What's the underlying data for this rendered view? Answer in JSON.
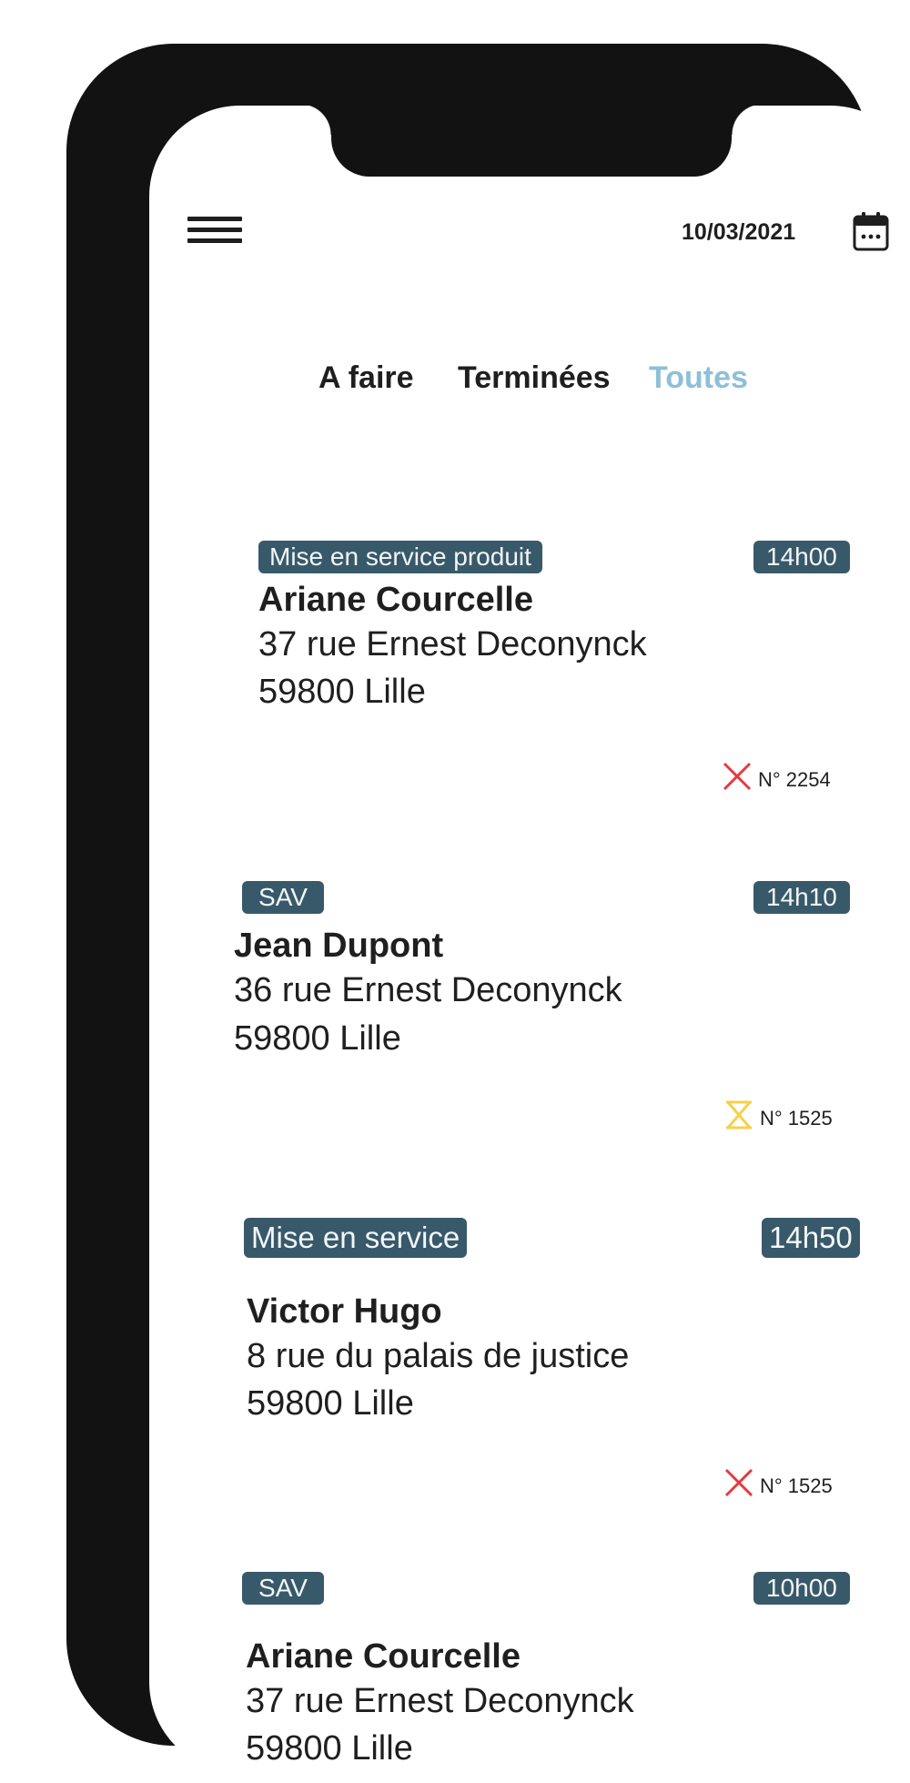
{
  "header": {
    "date": "10/03/2021",
    "menu_icon": "hamburger-icon",
    "calendar_icon": "calendar-icon"
  },
  "tabs": [
    {
      "label": "A faire",
      "active": false
    },
    {
      "label": "Terminées",
      "active": false
    },
    {
      "label": "Toutes",
      "active": true
    }
  ],
  "colors": {
    "badge": "#38596a",
    "active_tab": "#8ebfd8",
    "cancelled": "#e5393f",
    "pending": "#f5d04a"
  },
  "interventions": [
    {
      "type": "Mise en service produit",
      "time": "14h00",
      "name": "Ariane Courcelle",
      "address_line1": "37 rue Ernest Deconynck",
      "address_line2": "59800 Lille",
      "status_icon": "cross-icon",
      "number": "N° 2254"
    },
    {
      "type": "SAV",
      "time": "14h10",
      "name": "Jean Dupont",
      "address_line1": "36 rue Ernest Deconynck",
      "address_line2": "59800 Lille",
      "status_icon": "hourglass-icon",
      "number": "N° 1525"
    },
    {
      "type": "Mise en service",
      "time": "14h50",
      "name": "Victor Hugo",
      "address_line1": "8 rue du palais de justice",
      "address_line2": "59800 Lille",
      "status_icon": "cross-icon",
      "number": "N° 1525"
    },
    {
      "type": "SAV",
      "time": "10h00",
      "name": "Ariane Courcelle",
      "address_line1": "37 rue Ernest Deconynck",
      "address_line2": "59800 Lille"
    }
  ]
}
